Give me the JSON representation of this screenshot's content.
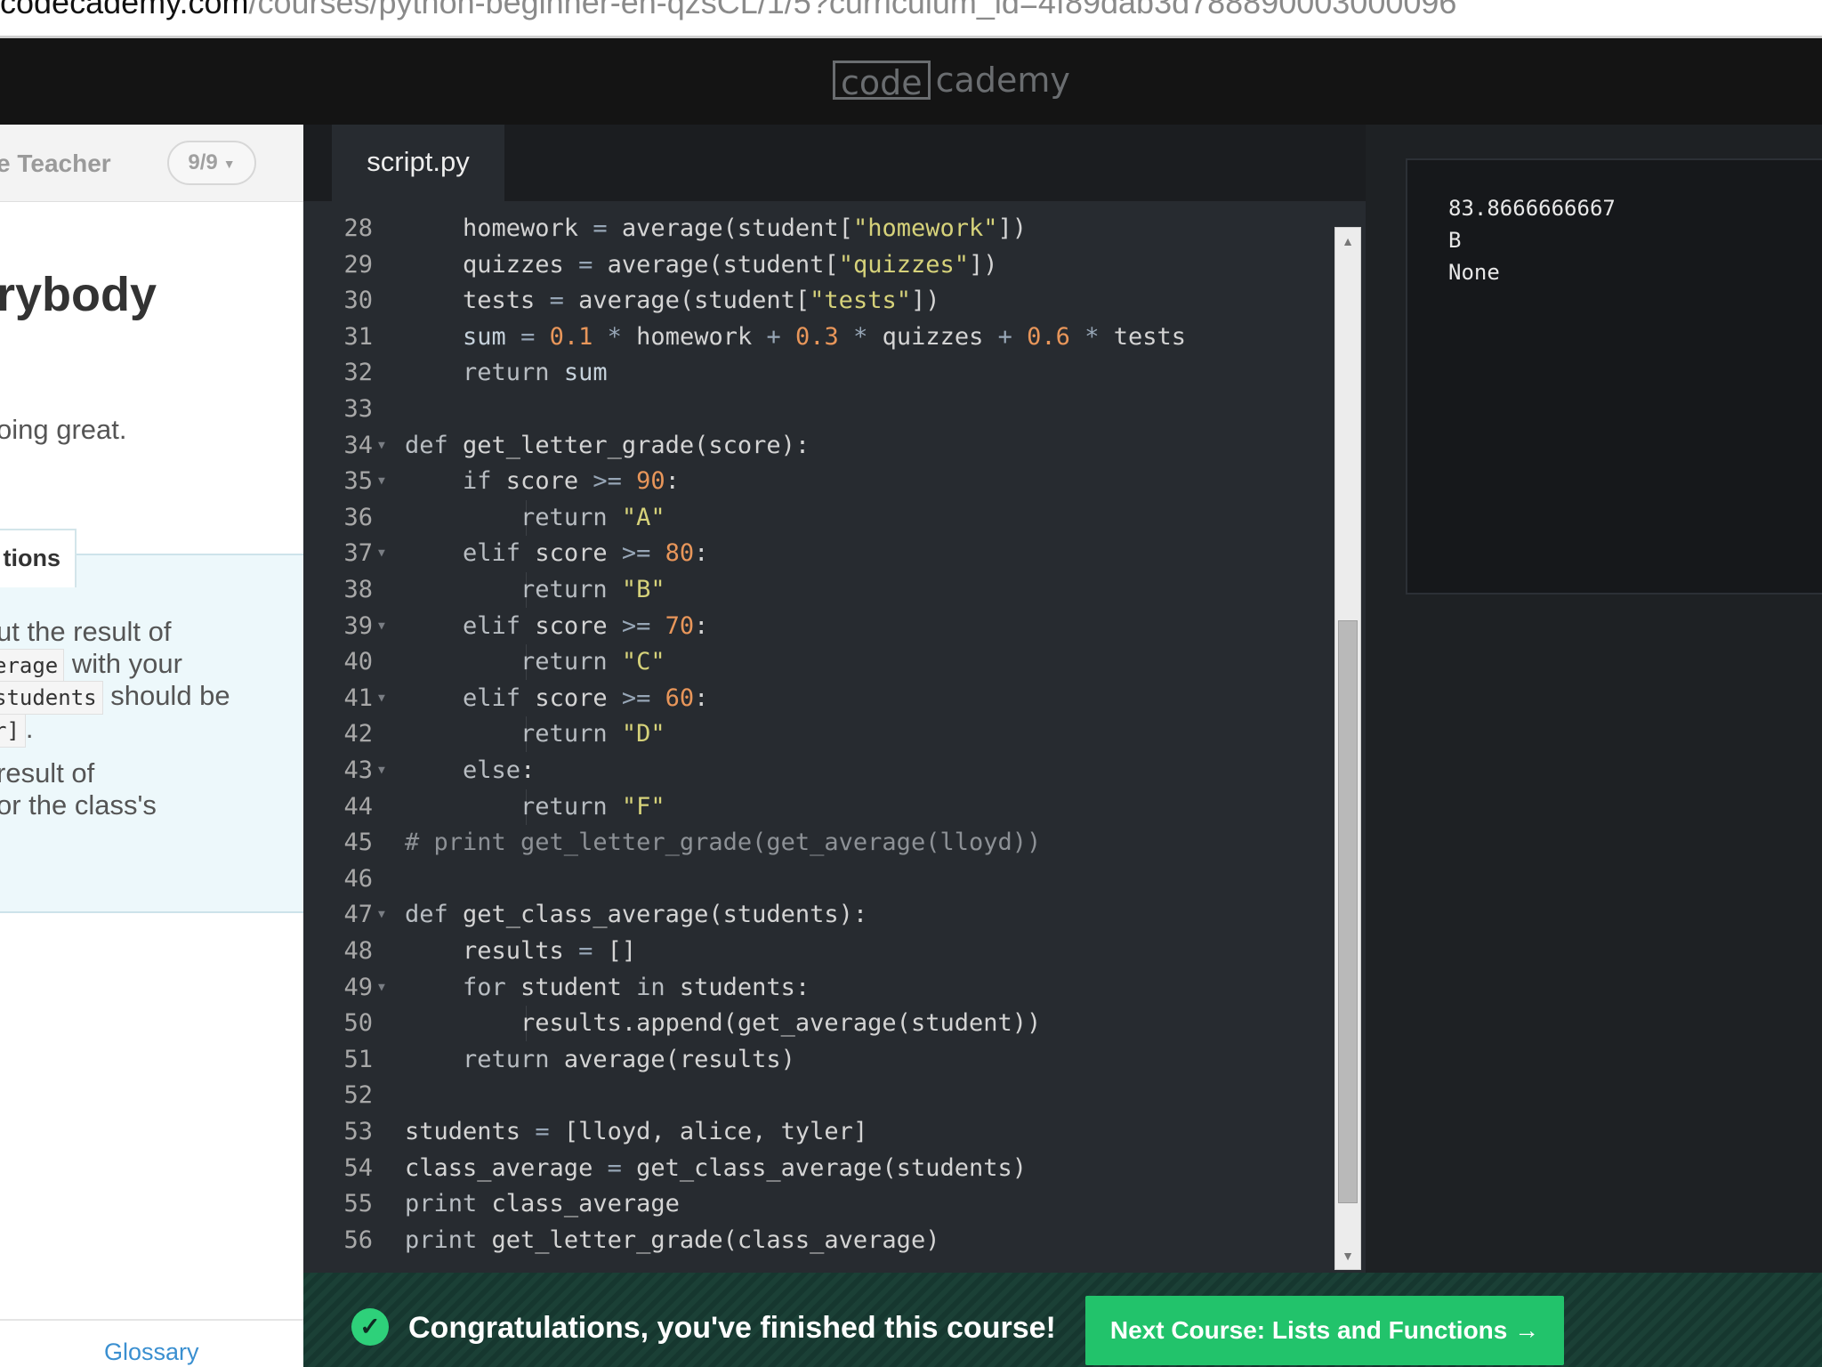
{
  "browser": {
    "url_host": "codecademy.com",
    "url_path": "/courses/python-beginner-en-qzsCL/1/5?curriculum_id=4f89dab3d788890003000096"
  },
  "header": {
    "logo_left": "code",
    "logo_right": "cademy"
  },
  "lesson": {
    "breadcrumb": "e Teacher",
    "counter": "9/9",
    "heading": "rybody",
    "intro": "oing great.",
    "instructions_tab": "tions",
    "instructions": {
      "line1": "ut the result of",
      "line2_code": "erage",
      "line2_text": " with your",
      "line3_code": "students",
      "line3_text": " should be",
      "line4_code": "r]",
      "line4_text": ".",
      "line5": " result of",
      "line6": "or the class's"
    },
    "footer_link": "Glossary"
  },
  "editor": {
    "tab": "script.py",
    "scroll_thumb_fraction_start": 0.37,
    "scroll_thumb_fraction_end": 0.96,
    "lines": [
      {
        "n": "28",
        "fold": false
      },
      {
        "n": "29",
        "fold": false
      },
      {
        "n": "30",
        "fold": false
      },
      {
        "n": "31",
        "fold": false
      },
      {
        "n": "32",
        "fold": false
      },
      {
        "n": "33",
        "fold": false
      },
      {
        "n": "34",
        "fold": true
      },
      {
        "n": "35",
        "fold": true
      },
      {
        "n": "36",
        "fold": false
      },
      {
        "n": "37",
        "fold": true
      },
      {
        "n": "38",
        "fold": false
      },
      {
        "n": "39",
        "fold": true
      },
      {
        "n": "40",
        "fold": false
      },
      {
        "n": "41",
        "fold": true
      },
      {
        "n": "42",
        "fold": false
      },
      {
        "n": "43",
        "fold": true
      },
      {
        "n": "44",
        "fold": false
      },
      {
        "n": "45",
        "fold": false
      },
      {
        "n": "46",
        "fold": false
      },
      {
        "n": "47",
        "fold": true
      },
      {
        "n": "48",
        "fold": false
      },
      {
        "n": "49",
        "fold": true
      },
      {
        "n": "50",
        "fold": false
      },
      {
        "n": "51",
        "fold": false
      },
      {
        "n": "52",
        "fold": false
      },
      {
        "n": "53",
        "fold": false
      },
      {
        "n": "54",
        "fold": false
      },
      {
        "n": "55",
        "fold": false
      },
      {
        "n": "56",
        "fold": false
      }
    ],
    "code": [
      "    homework = average(student[\"homework\"])",
      "    quizzes = average(student[\"quizzes\"])",
      "    tests = average(student[\"tests\"])",
      "    sum = 0.1 * homework + 0.3 * quizzes + 0.6 * tests",
      "    return sum",
      "",
      "def get_letter_grade(score):",
      "    if score >= 90:",
      "        return \"A\"",
      "    elif score >= 80:",
      "        return \"B\"",
      "    elif score >= 70:",
      "        return \"C\"",
      "    elif score >= 60:",
      "        return \"D\"",
      "    else:",
      "        return \"F\"",
      "# print get_letter_grade(get_average(lloyd))",
      "",
      "def get_class_average(students):",
      "    results = []",
      "    for student in students:",
      "        results.append(get_average(student))",
      "    return average(results)",
      "",
      "students = [lloyd, alice, tyler]",
      "class_average = get_class_average(students)",
      "print class_average",
      "print get_letter_grade(class_average)"
    ]
  },
  "output": {
    "lines": [
      "83.8666666667",
      "B",
      "None"
    ]
  },
  "congrats": {
    "check_icon": "✓",
    "message": "Congratulations, you've finished this course!",
    "next_button": "Next Course: Lists and Functions →"
  },
  "colors": {
    "editor_bg": "#272b30",
    "string": "#d6d27a",
    "number": "#e8965a",
    "accent_green": "#22c36b"
  }
}
